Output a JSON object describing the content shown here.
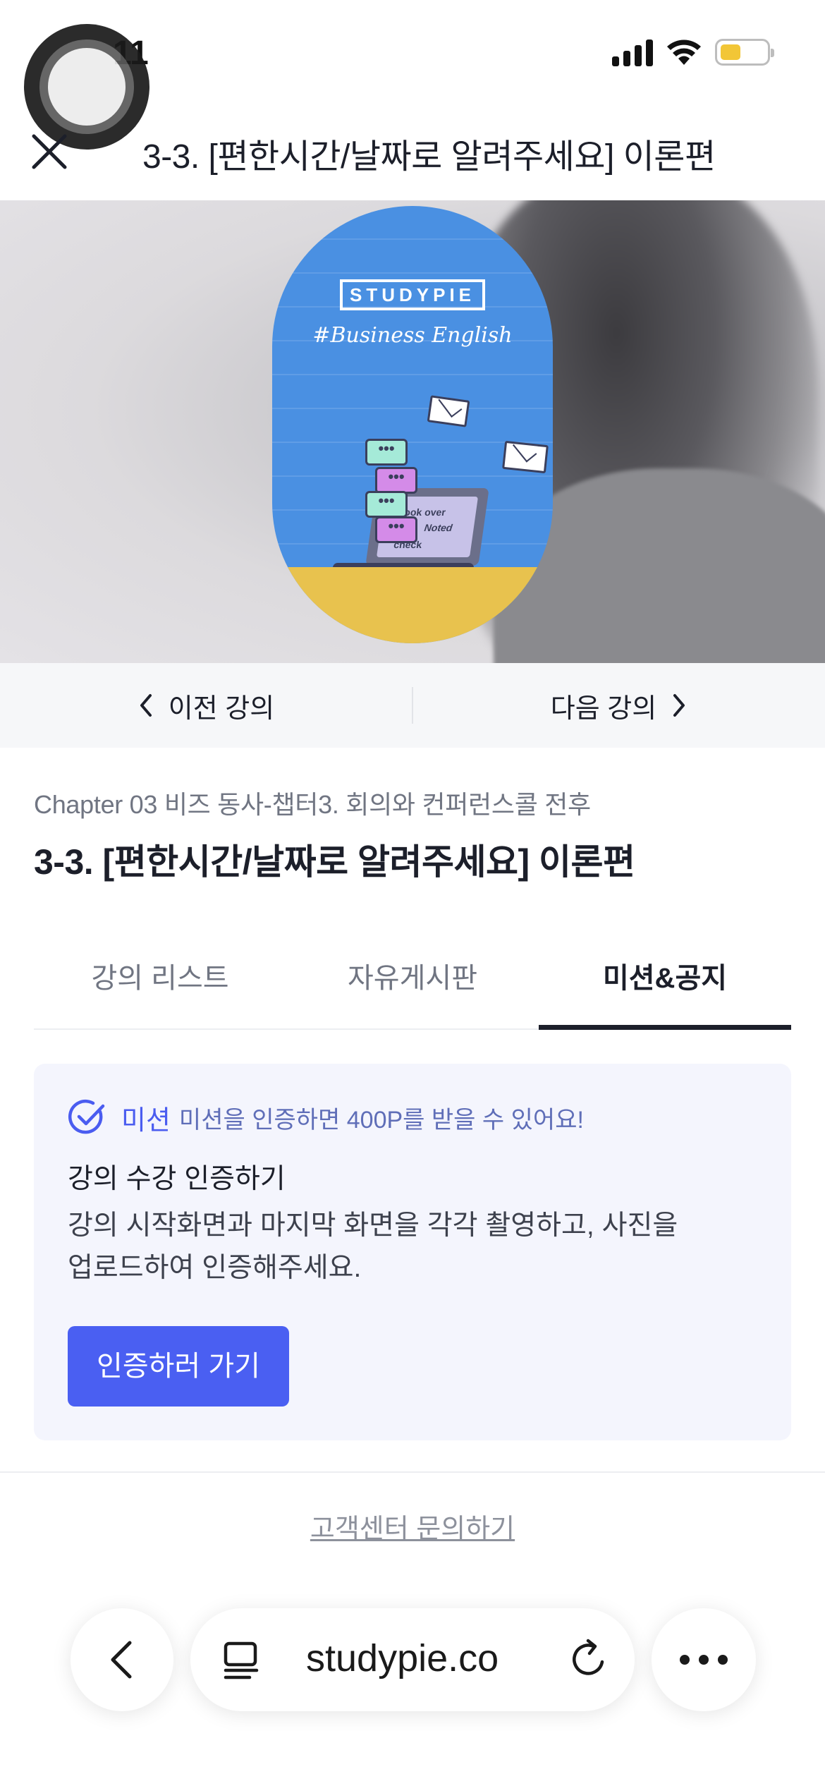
{
  "status_bar": {
    "time": "11"
  },
  "header": {
    "title": "3-3. [편한시간/날짜로 알려주세요] 이론편"
  },
  "video": {
    "brand": "STUDYPIE",
    "tagline": "#Business English",
    "bubbles": [
      "•••",
      "•••",
      "•••",
      "•••"
    ],
    "laptop_text": [
      "Look over",
      "Noted",
      "check"
    ]
  },
  "lecture_nav": {
    "prev_label": "이전 강의",
    "next_label": "다음 강의"
  },
  "lecture": {
    "chapter": "Chapter 03 비즈 동사-챕터3. 회의와 컨퍼런스콜 전후",
    "title": "3-3. [편한시간/날짜로 알려주세요] 이론편"
  },
  "tabs": [
    {
      "label": "강의 리스트",
      "active": false
    },
    {
      "label": "자유게시판",
      "active": false
    },
    {
      "label": "미션&공지",
      "active": true
    }
  ],
  "mission": {
    "label": "미션",
    "reward": "미션을 인증하면 400P를 받을 수 있어요!",
    "title": "강의 수강 인증하기",
    "description": "강의 시작화면과 마지막 화면을 각각 촬영하고, 사진을 업로드하여 인증해주세요.",
    "button": "인증하러 가기"
  },
  "support": {
    "link": "고객센터 문의하기"
  },
  "browser": {
    "url": "studypie.co"
  },
  "colors": {
    "accent": "#4a5ff2",
    "mission_bg": "#f4f5fd",
    "title": "#1c1f2a",
    "video_card": "#4a90e2"
  }
}
